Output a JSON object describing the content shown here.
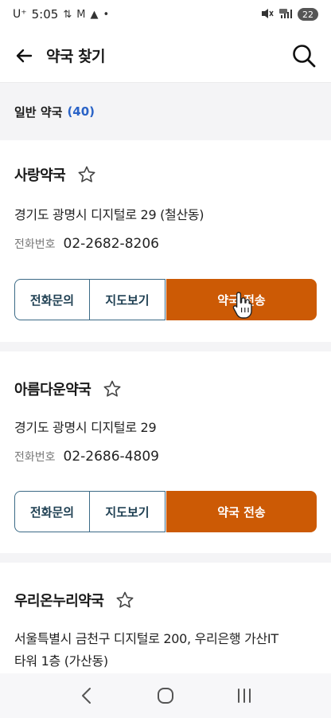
{
  "status_bar": {
    "carrier": "U⁺",
    "time": "5:05",
    "icons_left": [
      "signal-icon",
      "mail-icon",
      "alert-icon",
      "dot-icon"
    ],
    "battery": "22"
  },
  "header": {
    "title": "약국 찾기"
  },
  "section": {
    "label": "일반 약국",
    "count": "(40)"
  },
  "pharmacies": [
    {
      "name": "사랑약국",
      "address_lines": [
        "경기도 광명시 디지털로 29 (철산동)"
      ],
      "phone_label": "전화번호",
      "phone": "02-2682-8206",
      "btn_call": "전화문의",
      "btn_map": "지도보기",
      "btn_send": "약국 전송"
    },
    {
      "name": "아름다운약국",
      "address_lines": [
        "경기도 광명시 디지털로 29"
      ],
      "phone_label": "전화번호",
      "phone": "02-2686-4809",
      "btn_call": "전화문의",
      "btn_map": "지도보기",
      "btn_send": "약국 전송"
    },
    {
      "name": "우리온누리약국",
      "address_lines": [
        "서울특별시 금천구 디지털로 200, 우리은행 가산IT",
        "타워 1층 (가산동)"
      ]
    }
  ],
  "colors": {
    "accent": "#cc5a05",
    "outline": "#3b6a86",
    "count": "#2a63c7"
  },
  "nav_icons": [
    "back-nav-icon",
    "home-nav-icon",
    "recents-nav-icon"
  ]
}
